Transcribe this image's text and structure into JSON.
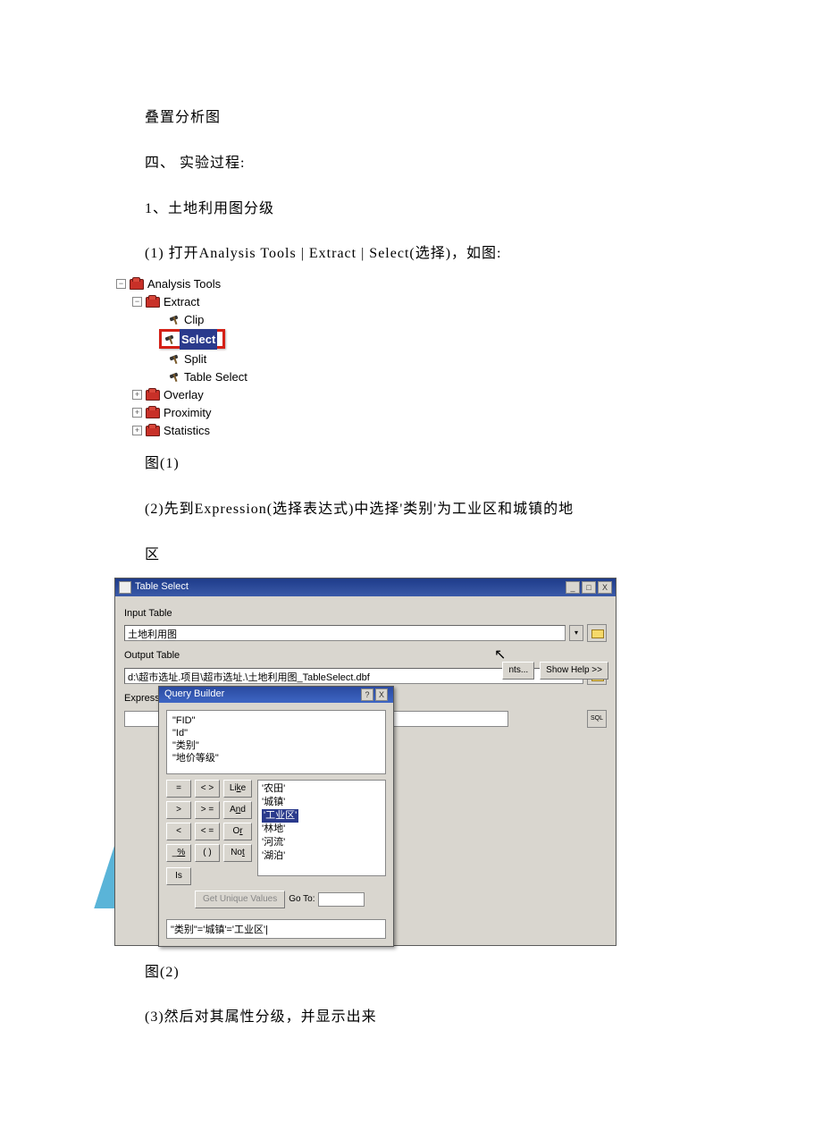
{
  "text": {
    "p1": "叠置分析图",
    "p2": "四、 实验过程:",
    "p3": "1、土地利用图分级",
    "p4": "(1) 打开Analysis Tools | Extract | Select(选择)，如图:",
    "fig1_cap": "图(1)",
    "p5": "(2)先到Expression(选择表达式)中选择'类别'为工业区和城镇的地",
    "p5b": "区",
    "fig2_cap": "图(2)",
    "p6": "(3)然后对其属性分级，并显示出来"
  },
  "tree": {
    "root": "Analysis Tools",
    "extract": "Extract",
    "clip": "Clip",
    "select": "Select",
    "split": "Split",
    "table_select": "Table Select",
    "overlay": "Overlay",
    "proximity": "Proximity",
    "statistics": "Statistics"
  },
  "dialog": {
    "title": "Table Select",
    "input_label": "Input Table",
    "input_value": "土地利用图",
    "output_label": "Output Table",
    "output_value": "d:\\超市选址.项目\\超市选址.\\土地利用图_TableSelect.dbf",
    "expr_label": "Expression (optional)",
    "env_btn": "nts...",
    "showhelp_btn": "Show Help >>",
    "sql_label": "SQL",
    "where_clause": "\"类别\"='城镇'='工业区'|"
  },
  "qb": {
    "title": "Query Builder",
    "fields": [
      "\"FID\"",
      "\"Id\"",
      "\"类别\"",
      "\"地价等级\""
    ],
    "ops": [
      "=",
      "< >",
      "Like",
      ">",
      ">=",
      "And",
      "<",
      "<=",
      "Or",
      "_",
      "%",
      "()   Not"
    ],
    "op_row4": [
      "_",
      "%",
      "( )",
      "Not"
    ],
    "is_btn": "Is",
    "values": [
      "'农田'",
      "'城镇'",
      "'工业区'",
      "'林地'",
      "'河流'",
      "'湖泊'"
    ],
    "unique_btn": "Get Unique Values",
    "goto_label": "Go To:"
  },
  "wincontrols": {
    "min": "_",
    "max": "□",
    "close": "X",
    "help": "?"
  }
}
